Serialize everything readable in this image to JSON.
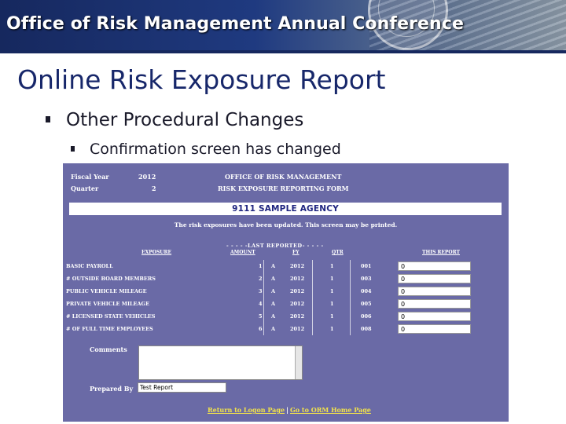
{
  "header": {
    "title": "Office of Risk Management Annual Conference"
  },
  "slide": {
    "title": "Online Risk Exposure Report",
    "bullet1": "Other Procedural Changes",
    "bullet2": "Confirmation screen has changed"
  },
  "form": {
    "fiscal_year_label": "Fiscal Year",
    "fiscal_year_value": "2012",
    "quarter_label": "Quarter",
    "quarter_value": "2",
    "office_title": "OFFICE OF RISK MANAGEMENT",
    "form_title": "RISK EXPOSURE REPORTING FORM",
    "agency_name": "9111 SAMPLE AGENCY",
    "message": "The risk exposures have been updated. This screen may be printed.",
    "last_reported_header": "- - - - -LAST REPORTED- - - - -",
    "columns": [
      "EXPOSURE",
      "AMOUNT",
      "FY",
      "QTR",
      "THIS REPORT"
    ],
    "rows": [
      {
        "exposure": "BASIC PAYROLL",
        "amount": "1",
        "code": "A",
        "fy": "2012",
        "qtr": "1",
        "num": "001",
        "value": "0"
      },
      {
        "exposure": "# OUTSIDE BOARD MEMBERS",
        "amount": "2",
        "code": "A",
        "fy": "2012",
        "qtr": "1",
        "num": "003",
        "value": "0"
      },
      {
        "exposure": "PUBLIC VEHICLE MILEAGE",
        "amount": "3",
        "code": "A",
        "fy": "2012",
        "qtr": "1",
        "num": "004",
        "value": "0"
      },
      {
        "exposure": "PRIVATE VEHICLE MILEAGE",
        "amount": "4",
        "code": "A",
        "fy": "2012",
        "qtr": "1",
        "num": "005",
        "value": "0"
      },
      {
        "exposure": "# LICENSED STATE VEHICLES",
        "amount": "5",
        "code": "A",
        "fy": "2012",
        "qtr": "1",
        "num": "006",
        "value": "0"
      },
      {
        "exposure": "# OF FULL TIME EMPLOYEES",
        "amount": "6",
        "code": "A",
        "fy": "2012",
        "qtr": "1",
        "num": "008",
        "value": "0"
      }
    ],
    "comments_label": "Comments",
    "prepared_by_label": "Prepared By",
    "prepared_by_value": "Test Report",
    "link_logon": "Return to Logon Page",
    "link_separator": "|",
    "link_home": "Go to ORM Home Page"
  }
}
